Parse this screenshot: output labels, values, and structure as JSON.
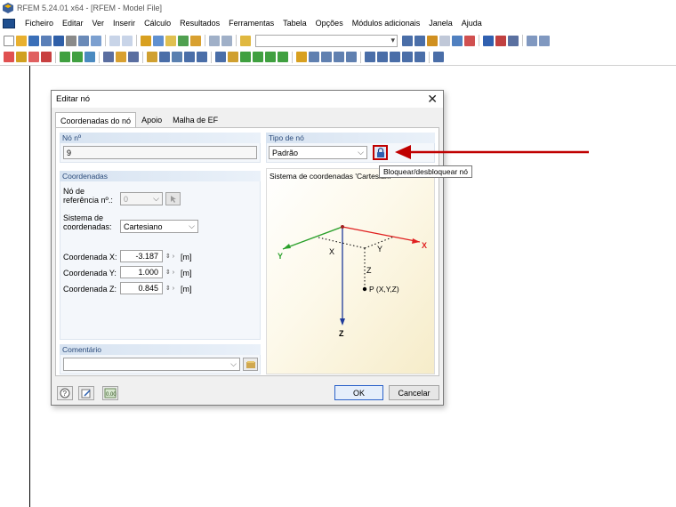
{
  "window": {
    "title": "RFEM 5.24.01 x64 - [RFEM - Model File]"
  },
  "menu": [
    "Ficheiro",
    "Editar",
    "Ver",
    "Inserir",
    "Cálculo",
    "Resultados",
    "Ferramentas",
    "Tabela",
    "Opções",
    "Módulos adicionais",
    "Janela",
    "Ajuda"
  ],
  "dialog": {
    "title": "Editar nó",
    "tabs": [
      "Coordenadas do nó",
      "Apoio",
      "Malha de EF"
    ],
    "node_no": {
      "label": "Nó nº",
      "value": "9"
    },
    "node_type": {
      "label": "Tipo de nó",
      "value": "Padrão"
    },
    "tooltip": "Bloquear/desbloquear nó",
    "coords": {
      "header": "Coordenadas",
      "ref_node_label_1": "Nó de",
      "ref_node_label_2": "referência nº.:",
      "ref_node_value": "0",
      "system_label_1": "Sistema de",
      "system_label_2": "coordenadas:",
      "system_value": "Cartesiano",
      "x_label": "Coordenada X:",
      "x_value": "-3.187",
      "x_unit": "[m]",
      "y_label": "Coordenada Y:",
      "y_value": "1.000",
      "y_unit": "[m]",
      "z_label": "Coordenada Z:",
      "z_value": "0.845",
      "z_unit": "[m]"
    },
    "comment": {
      "header": "Comentário",
      "value": ""
    },
    "preview": {
      "caption": "Sistema de coordenadas 'Cartesia...",
      "axis_x": "X",
      "axis_y": "Y",
      "axis_z": "Z",
      "dim_x": "X",
      "dim_y": "Y",
      "dim_z": "Z",
      "point_label": "P (X,Y,Z)"
    },
    "ok": "OK",
    "cancel": "Cancelar"
  },
  "colors": {
    "arrow": "#c00000",
    "axis_x": "#e02020",
    "axis_y": "#2aa02a",
    "axis_z": "#1e3a9a"
  }
}
